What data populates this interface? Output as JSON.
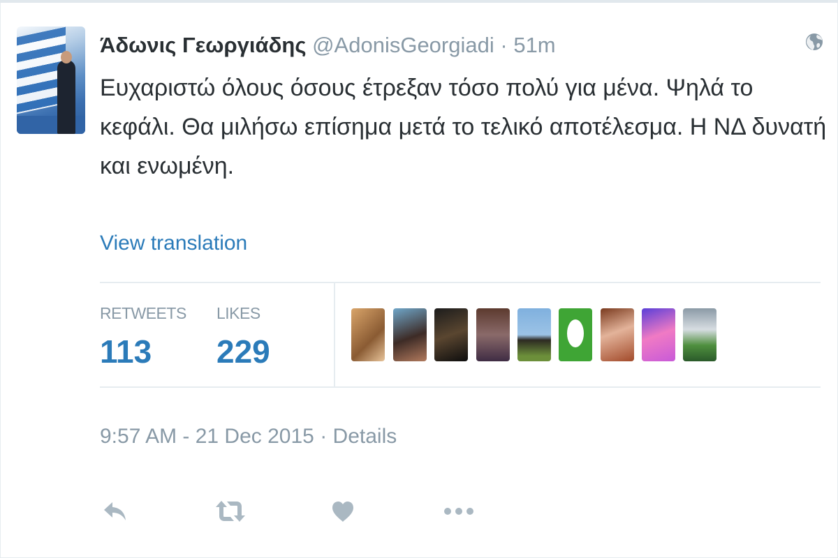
{
  "tweet": {
    "author_name": "Άδωνις Γεωργιάδης",
    "author_handle": "@AdonisGeorgiadi",
    "separator": "·",
    "time_ago": "51m",
    "text": "Ευχαριστώ όλους όσους έτρεξαν τόσο πολύ για μένα. Ψηλά το κεφάλι. Θα μιλήσω επίσημα μετά το τελικό αποτέλεσμα. Η ΝΔ δυνατή και ενωμένη.",
    "translation_link": "View translation",
    "timestamp": "9:57 AM - 21 Dec 2015",
    "details_link": "Details"
  },
  "stats": {
    "retweets_label": "RETWEETS",
    "retweets_value": "113",
    "likes_label": "LIKES",
    "likes_value": "229"
  },
  "actions": {
    "reply_icon": "reply-icon",
    "retweet_icon": "retweet-icon",
    "like_icon": "heart-icon",
    "more_icon": "more-icon"
  },
  "colors": {
    "link": "#2b7bb9",
    "muted": "#8899a6",
    "text": "#292f33",
    "action_icon": "#aab8c2"
  }
}
